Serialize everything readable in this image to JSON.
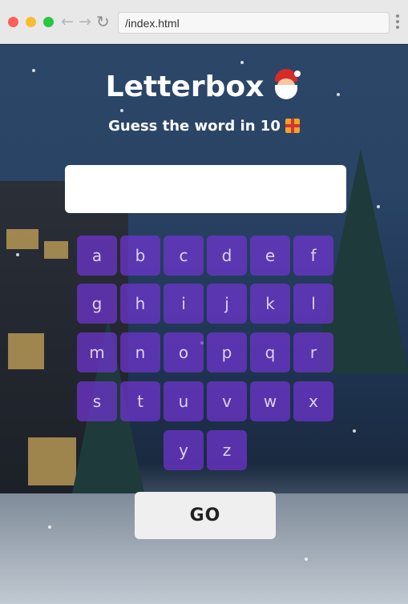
{
  "browser": {
    "url": "/index.html",
    "back_icon": "←",
    "forward_icon": "→",
    "reload_icon": "↻"
  },
  "app": {
    "title": "Letterbox",
    "title_icon": "santa-face-icon",
    "subtitle": "Guess the word in 10",
    "subtitle_icon": "gift-icon",
    "guess_value": "",
    "submit_label": "GO",
    "accent_color": "#7034d2"
  },
  "keyboard": {
    "keys": [
      "a",
      "b",
      "c",
      "d",
      "e",
      "f",
      "g",
      "h",
      "i",
      "j",
      "k",
      "l",
      "m",
      "n",
      "o",
      "p",
      "q",
      "r",
      "s",
      "t",
      "u",
      "v",
      "w",
      "x",
      "y",
      "z"
    ]
  }
}
